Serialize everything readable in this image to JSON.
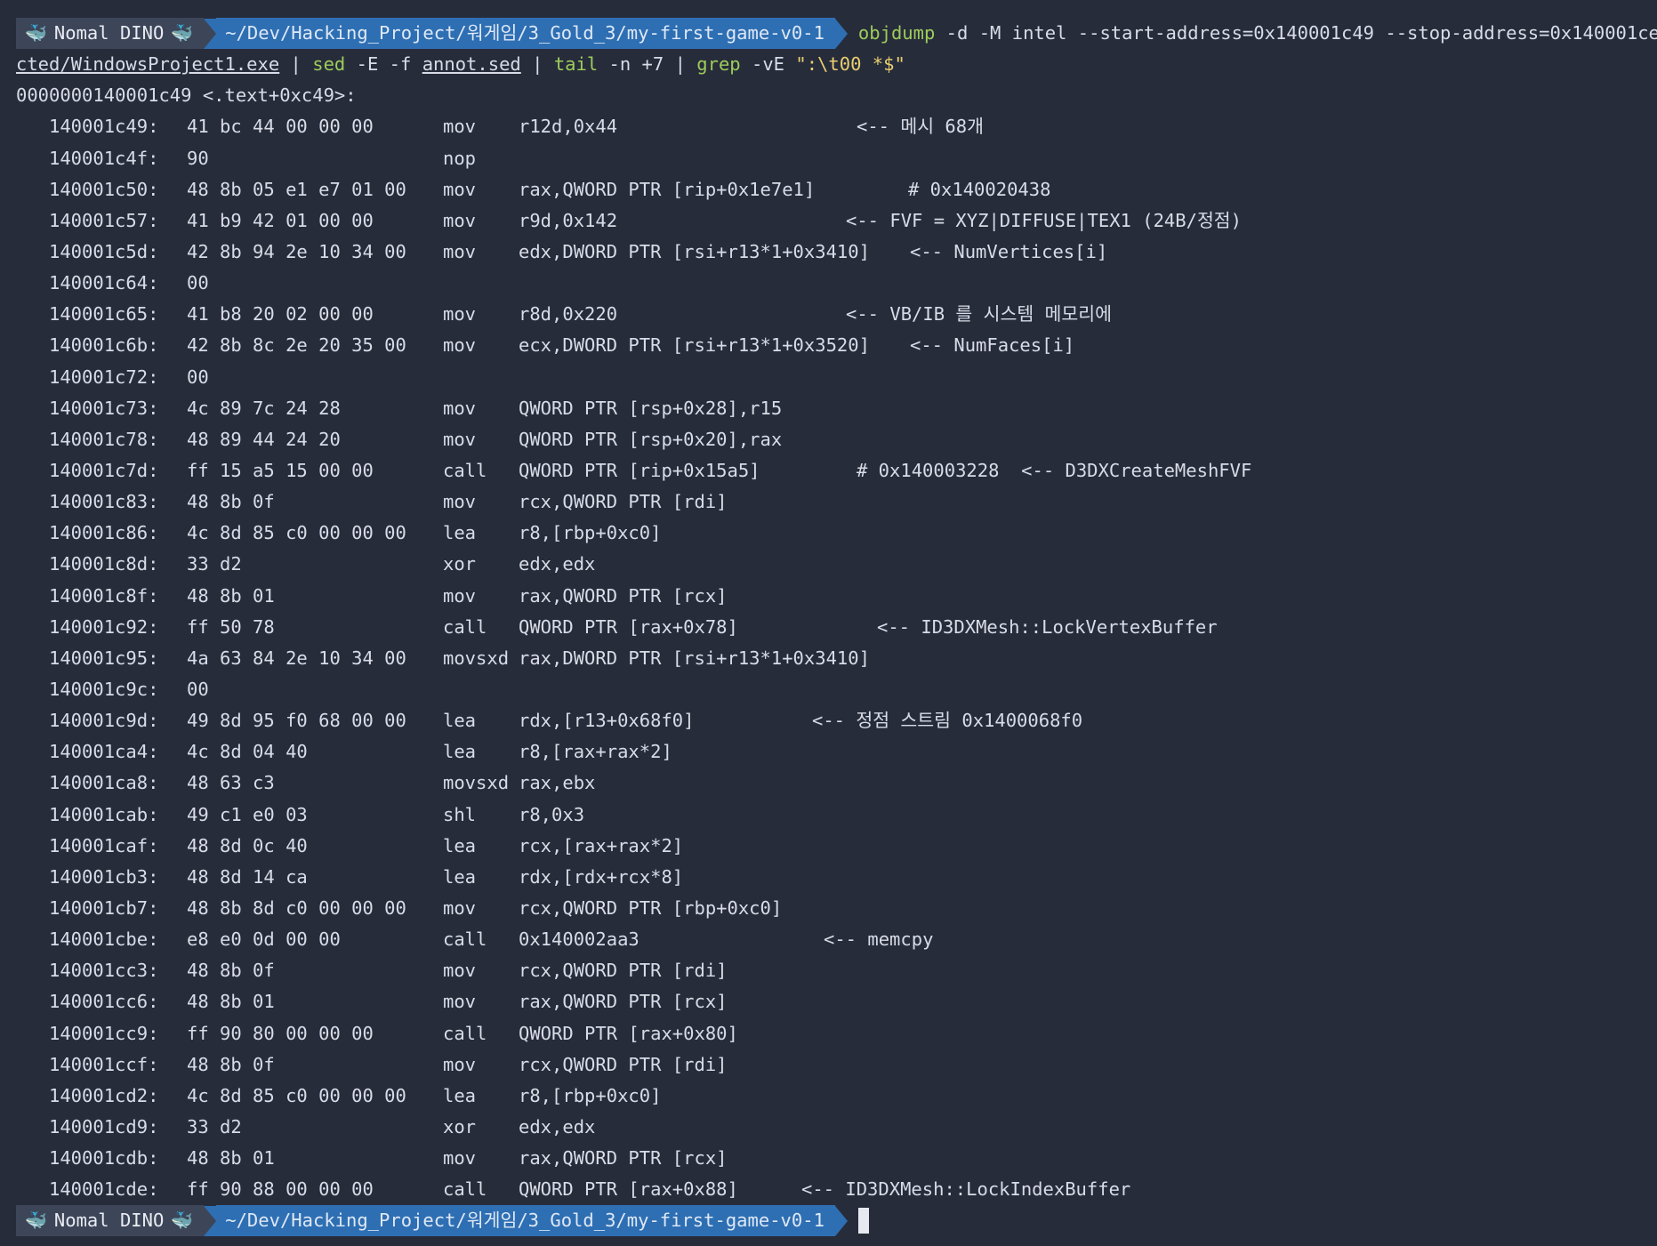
{
  "prompt": {
    "user_label": "Nomal DINO",
    "user_icon": "whale-icon",
    "path": "~/Dev/Hacking_Project/워게임/3_Gold_3/my-first-game-v0-1",
    "colors": {
      "user_bg": "#3d4558",
      "path_bg": "#2e6fb3",
      "command": "#9dcc5a",
      "string": "#e8cf6f",
      "background": "#272c3b"
    }
  },
  "command": {
    "line1": {
      "prog": "objdump",
      "args": " -d -M intel --start-address=0x140001c49 --stop-address=0x140001ce"
    },
    "line2": {
      "file": "cted/WindowsProject1.exe",
      "pipe1": " | ",
      "sed": "sed",
      "sed_args": " -E -f ",
      "sed_file": "annot.sed",
      "pipe2": " | ",
      "tail": "tail",
      "tail_args": " -n +7 | ",
      "grep": "grep",
      "grep_args": " -vE ",
      "grep_pattern": "\":\\t00 *$\""
    }
  },
  "section_header": "0000000140001c49 <.text+0xc49>:",
  "rows": [
    {
      "addr": "140001c49:",
      "bytes": "41 bc 44 00 00 00",
      "mnem": "mov",
      "ops": "r12d,0x44",
      "comment": "<-- 메시 68개"
    },
    {
      "addr": "140001c4f:",
      "bytes": "90",
      "mnem": "nop",
      "ops": "",
      "comment": ""
    },
    {
      "addr": "140001c50:",
      "bytes": "48 8b 05 e1 e7 01 00",
      "mnem": "mov",
      "ops": "rax,QWORD PTR [rip+0x1e7e1]",
      "comment": "# 0x140020438"
    },
    {
      "addr": "140001c57:",
      "bytes": "41 b9 42 01 00 00",
      "mnem": "mov",
      "ops": "r9d,0x142",
      "comment": "<-- FVF = XYZ|DIFFUSE|TEX1 (24B/정점)"
    },
    {
      "addr": "140001c5d:",
      "bytes": "42 8b 94 2e 10 34 00",
      "mnem": "mov",
      "ops": "edx,DWORD PTR [rsi+r13*1+0x3410]",
      "comment": "<-- NumVertices[i]"
    },
    {
      "addr": "140001c64:",
      "bytes": "00",
      "mnem": "",
      "ops": "",
      "comment": ""
    },
    {
      "addr": "140001c65:",
      "bytes": "41 b8 20 02 00 00",
      "mnem": "mov",
      "ops": "r8d,0x220",
      "comment": "<-- VB/IB 를 시스템 메모리에"
    },
    {
      "addr": "140001c6b:",
      "bytes": "42 8b 8c 2e 20 35 00",
      "mnem": "mov",
      "ops": "ecx,DWORD PTR [rsi+r13*1+0x3520]",
      "comment": "<-- NumFaces[i]"
    },
    {
      "addr": "140001c72:",
      "bytes": "00",
      "mnem": "",
      "ops": "",
      "comment": ""
    },
    {
      "addr": "140001c73:",
      "bytes": "4c 89 7c 24 28",
      "mnem": "mov",
      "ops": "QWORD PTR [rsp+0x28],r15",
      "comment": ""
    },
    {
      "addr": "140001c78:",
      "bytes": "48 89 44 24 20",
      "mnem": "mov",
      "ops": "QWORD PTR [rsp+0x20],rax",
      "comment": ""
    },
    {
      "addr": "140001c7d:",
      "bytes": "ff 15 a5 15 00 00",
      "mnem": "call",
      "ops": "QWORD PTR [rip+0x15a5]",
      "comment": "# 0x140003228  <-- D3DXCreateMeshFVF"
    },
    {
      "addr": "140001c83:",
      "bytes": "48 8b 0f",
      "mnem": "mov",
      "ops": "rcx,QWORD PTR [rdi]",
      "comment": ""
    },
    {
      "addr": "140001c86:",
      "bytes": "4c 8d 85 c0 00 00 00",
      "mnem": "lea",
      "ops": "r8,[rbp+0xc0]",
      "comment": ""
    },
    {
      "addr": "140001c8d:",
      "bytes": "33 d2",
      "mnem": "xor",
      "ops": "edx,edx",
      "comment": ""
    },
    {
      "addr": "140001c8f:",
      "bytes": "48 8b 01",
      "mnem": "mov",
      "ops": "rax,QWORD PTR [rcx]",
      "comment": ""
    },
    {
      "addr": "140001c92:",
      "bytes": "ff 50 78",
      "mnem": "call",
      "ops": "QWORD PTR [rax+0x78]",
      "comment": "<-- ID3DXMesh::LockVertexBuffer"
    },
    {
      "addr": "140001c95:",
      "bytes": "4a 63 84 2e 10 34 00",
      "mnem": "movsxd",
      "ops": "rax,DWORD PTR [rsi+r13*1+0x3410]",
      "comment": ""
    },
    {
      "addr": "140001c9c:",
      "bytes": "00",
      "mnem": "",
      "ops": "",
      "comment": ""
    },
    {
      "addr": "140001c9d:",
      "bytes": "49 8d 95 f0 68 00 00",
      "mnem": "lea",
      "ops": "rdx,[r13+0x68f0]",
      "comment": "<-- 정점 스트림 0x1400068f0"
    },
    {
      "addr": "140001ca4:",
      "bytes": "4c 8d 04 40",
      "mnem": "lea",
      "ops": "r8,[rax+rax*2]",
      "comment": ""
    },
    {
      "addr": "140001ca8:",
      "bytes": "48 63 c3",
      "mnem": "movsxd",
      "ops": "rax,ebx",
      "comment": ""
    },
    {
      "addr": "140001cab:",
      "bytes": "49 c1 e0 03",
      "mnem": "shl",
      "ops": "r8,0x3",
      "comment": ""
    },
    {
      "addr": "140001caf:",
      "bytes": "48 8d 0c 40",
      "mnem": "lea",
      "ops": "rcx,[rax+rax*2]",
      "comment": ""
    },
    {
      "addr": "140001cb3:",
      "bytes": "48 8d 14 ca",
      "mnem": "lea",
      "ops": "rdx,[rdx+rcx*8]",
      "comment": ""
    },
    {
      "addr": "140001cb7:",
      "bytes": "48 8b 8d c0 00 00 00",
      "mnem": "mov",
      "ops": "rcx,QWORD PTR [rbp+0xc0]",
      "comment": ""
    },
    {
      "addr": "140001cbe:",
      "bytes": "e8 e0 0d 00 00",
      "mnem": "call",
      "ops": "0x140002aa3",
      "comment": "<-- memcpy"
    },
    {
      "addr": "140001cc3:",
      "bytes": "48 8b 0f",
      "mnem": "mov",
      "ops": "rcx,QWORD PTR [rdi]",
      "comment": ""
    },
    {
      "addr": "140001cc6:",
      "bytes": "48 8b 01",
      "mnem": "mov",
      "ops": "rax,QWORD PTR [rcx]",
      "comment": ""
    },
    {
      "addr": "140001cc9:",
      "bytes": "ff 90 80 00 00 00",
      "mnem": "call",
      "ops": "QWORD PTR [rax+0x80]",
      "comment": ""
    },
    {
      "addr": "140001ccf:",
      "bytes": "48 8b 0f",
      "mnem": "mov",
      "ops": "rcx,QWORD PTR [rdi]",
      "comment": ""
    },
    {
      "addr": "140001cd2:",
      "bytes": "4c 8d 85 c0 00 00 00",
      "mnem": "lea",
      "ops": "r8,[rbp+0xc0]",
      "comment": ""
    },
    {
      "addr": "140001cd9:",
      "bytes": "33 d2",
      "mnem": "xor",
      "ops": "edx,edx",
      "comment": ""
    },
    {
      "addr": "140001cdb:",
      "bytes": "48 8b 01",
      "mnem": "mov",
      "ops": "rax,QWORD PTR [rcx]",
      "comment": ""
    },
    {
      "addr": "140001cde:",
      "bytes": "ff 90 88 00 00 00",
      "mnem": "call",
      "ops": "QWORD PTR [rax+0x88]",
      "comment": "<-- ID3DXMesh::LockIndexBuffer"
    }
  ]
}
